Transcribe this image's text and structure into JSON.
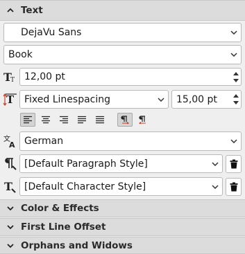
{
  "sections": {
    "text": "Text",
    "color_effects": "Color & Effects",
    "first_line_offset": "First Line Offset",
    "orphans_widows": "Orphans and Widows"
  },
  "font_family": "DejaVu Sans",
  "font_style": "Book",
  "font_size": "12,00 pt",
  "linespacing_mode": "Fixed Linespacing",
  "linespacing_value": "15,00 pt",
  "language": "German",
  "paragraph_style": "[Default Paragraph Style]",
  "character_style": "[Default Character Style]",
  "colors": {
    "header_bg": "#dcdcdc",
    "panel_bg": "#efefef",
    "accent_red": "#d23a2a",
    "accent_blue": "#2f6fc8"
  }
}
